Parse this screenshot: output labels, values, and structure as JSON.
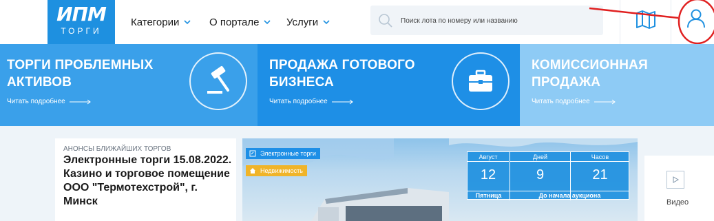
{
  "logo": {
    "main": "ИПМ",
    "sub": "ТОРГИ"
  },
  "nav": {
    "items": [
      {
        "label": "Категории"
      },
      {
        "label": "О портале"
      },
      {
        "label": "Услуги"
      }
    ]
  },
  "search": {
    "placeholder": "Поиск лота по номеру или названию"
  },
  "banners": [
    {
      "title": "ТОРГИ ПРОБЛЕМНЫХ АКТИВОВ",
      "link": "Читать подробнее",
      "color": "#3aa0ea",
      "icon": "gavel-icon"
    },
    {
      "title": "ПРОДАЖА ГОТОВОГО БИЗНЕСА",
      "link": "Читать подробнее",
      "color": "#1e8fe6",
      "icon": "briefcase-icon"
    },
    {
      "title": "КОМИССИОННАЯ ПРОДАЖА",
      "link": "Читать подробнее",
      "color": "#8ecbf5",
      "icon": "handshake-icon"
    }
  ],
  "announce": {
    "label": "АНОНСЫ БЛИЖАЙШИХ ТОРГОВ",
    "title": "Электронные торги 15.08.2022. Казино и торговое помещение ООО \"Термотехстрой\", г. Минск"
  },
  "tags": [
    {
      "label": "Электронные торги",
      "color": "#1e8fe6"
    },
    {
      "label": "Недвижимость",
      "color": "#f0b429"
    }
  ],
  "counter": {
    "month_label": "Август",
    "day_num": "12",
    "weekday": "Пятница",
    "days_label": "Дней",
    "days_val": "9",
    "hours_label": "Часов",
    "hours_val": "21",
    "footer": "До начала аукциона"
  },
  "video": {
    "label": "Видео"
  },
  "colors": {
    "accent": "#1e90e0",
    "annotation": "#e02020"
  }
}
